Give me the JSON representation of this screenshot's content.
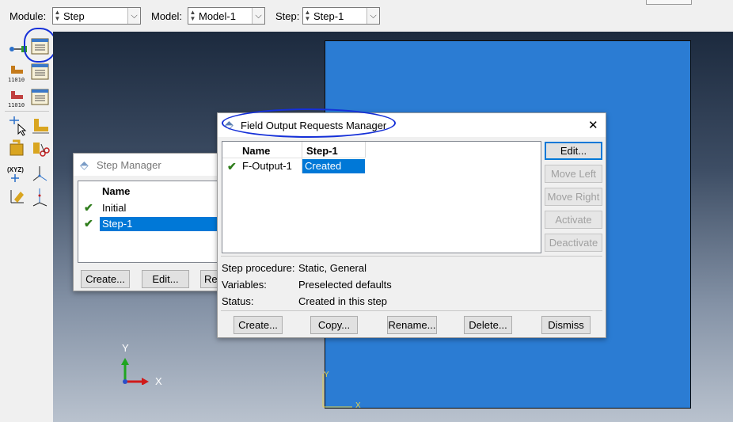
{
  "context_bar": {
    "module_label": "Module:",
    "module_value": "Step",
    "model_label": "Model:",
    "model_value": "Model-1",
    "step_label": "Step:",
    "step_value": "Step-1"
  },
  "toolbox": {
    "xyz_label": "(XYZ)",
    "axis_digits": "11010"
  },
  "viewport": {
    "triad_y": "Y",
    "triad_x": "X",
    "part_axis_y": "Y",
    "part_axis_x": "X",
    "part_color": "#2b7cd3"
  },
  "step_manager": {
    "title": "Step Manager",
    "column_header": "Name",
    "rows": [
      "Initial",
      "Step-1"
    ],
    "buttons": {
      "create": "Create...",
      "edit": "Edit...",
      "partial": "Re"
    }
  },
  "field_output_manager": {
    "title": "Field Output Requests Manager",
    "close_glyph": "✕",
    "columns": {
      "name": "Name",
      "step": "Step-1"
    },
    "rows": [
      {
        "name": "F-Output-1",
        "status": "Created"
      }
    ],
    "side_buttons": {
      "edit": "Edit...",
      "move_left": "Move Left",
      "move_right": "Move Right",
      "activate": "Activate",
      "deactivate": "Deactivate"
    },
    "info": {
      "procedure_label": "Step procedure:",
      "procedure_value": "Static, General",
      "variables_label": "Variables:",
      "variables_value": "Preselected defaults",
      "status_label": "Status:",
      "status_value": "Created in this step"
    },
    "bottom_buttons": {
      "create": "Create...",
      "copy": "Copy...",
      "rename": "Rename...",
      "delete": "Delete...",
      "dismiss": "Dismiss"
    }
  },
  "colors": {
    "accent": "#0078d7",
    "check": "#2f7d1c",
    "annotation": "#1530d8"
  }
}
